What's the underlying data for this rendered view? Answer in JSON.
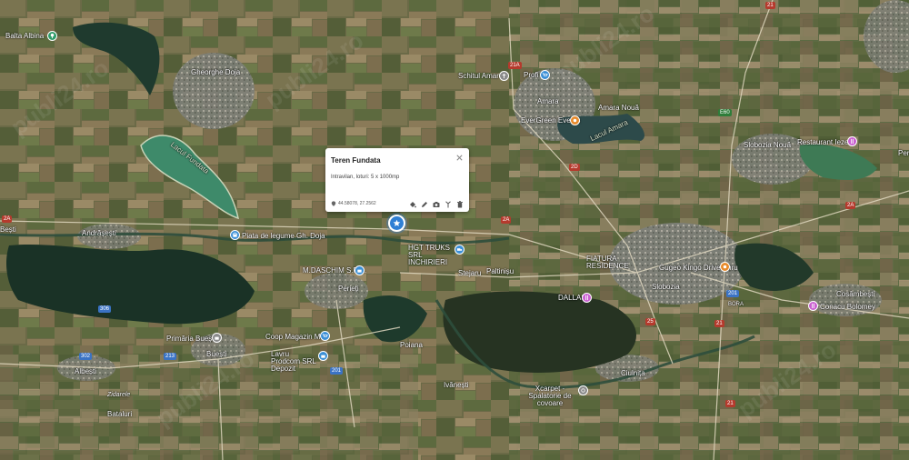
{
  "popup": {
    "title": "Teren Fundata",
    "description": "Intravilan, loturi: 5 x 1000mp",
    "coords": "44.58078, 27.2562"
  },
  "labels": {
    "balta_albina": "Balta Albina",
    "gheorghe_doja": "Gheorghe Doja",
    "lacul_fundata": "Lacul Fundata",
    "schitul_amara": "Schitul Amara",
    "profi": "Profi",
    "amara": "Amara",
    "amara_noua": "Amara Nouă",
    "evergreen": "EverGreen Events",
    "lacul_amara": "Lacul Amara",
    "slobozia_noua": "Slobozia Nouă",
    "restaurant_iezer": "Restaurant Iezer",
    "peri": "Peri",
    "bestii": "Bești",
    "andrasesti": "Andrășești",
    "piata_legume": "Piata de legume Gh. Doja",
    "hgt_truks": "HGT TRUKS SRL INCHIRIERI",
    "stejaru": "Stejaru",
    "paltinisu": "Paltinișu",
    "mdaschim": "M.DASCHIM S.R.L.",
    "perieti": "Perieți",
    "fiatura": "FIATURA RESIDENCE",
    "dallas": "DALLAS",
    "gugeo": "Gugeo Kingo Drive-Thru",
    "slobozia": "Slobozia",
    "bora": "BORA",
    "cosambesti": "Cosâmbești",
    "conacu": "Conacu Bolomey",
    "primaria_buesti": "Primăria Buești",
    "coop": "Coop Magazin Mixt",
    "buesti": "Buești",
    "lavru": "Lavru Prodcom SRL Depozit",
    "albesti": "Albești",
    "zidarele": "Zidarele",
    "bataluri": "Bataluri",
    "poiana": "Poiana",
    "ivanesti": "Ivănești",
    "xcarpet": "Xcarpet - Spalatorie de covoare",
    "ciulnita": "Ciulnița"
  },
  "roads": {
    "r21_top": "21",
    "r21_mid": "21",
    "r21_bot": "21",
    "r2a_w": "2A",
    "r2a_mid": "2A",
    "r2a_e": "2A",
    "r201": "201",
    "r201b": "201",
    "r306": "306",
    "r302": "302",
    "r213": "213",
    "r21a": "21A",
    "re60": "E60",
    "r2d": "2D",
    "r25": "25"
  },
  "colors": {
    "marker": "#2f7fd4",
    "pin_blue": "#3b8fd6",
    "pin_pink": "#c95fd0",
    "pin_orange": "#e88a2b",
    "pin_grey": "#8a8a8a"
  },
  "watermark": "publi24.ro"
}
